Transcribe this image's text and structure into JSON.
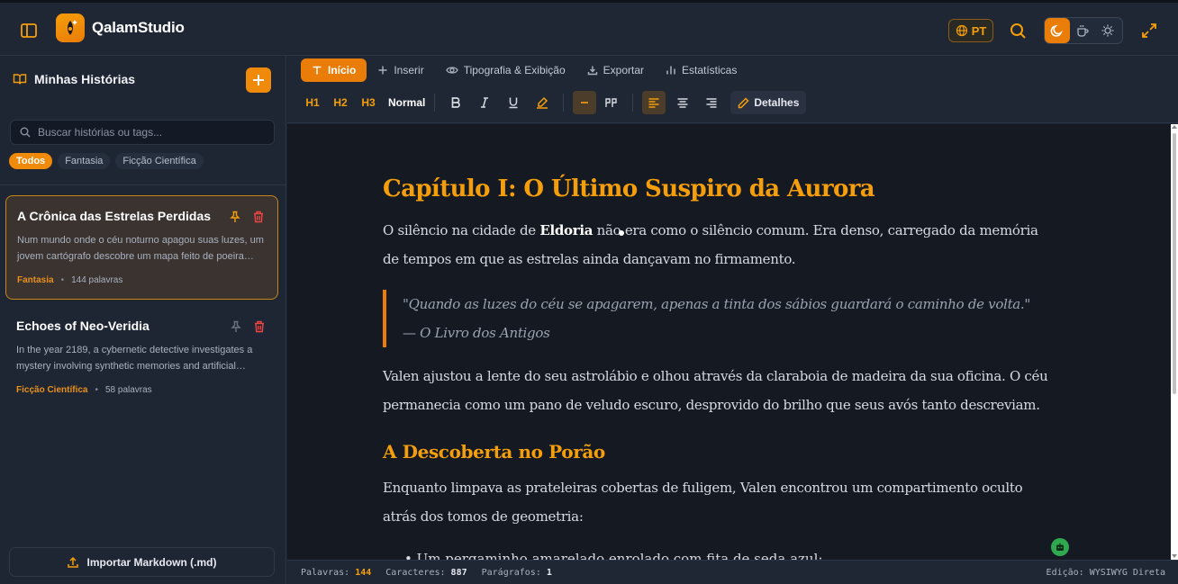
{
  "app": {
    "title": "QalamStudio",
    "language": "PT"
  },
  "sidebar": {
    "title": "Minhas Histórias",
    "search_placeholder": "Buscar histórias ou tags...",
    "tags": [
      "Todos",
      "Fantasia",
      "Ficção Científica"
    ],
    "active_tag": "Todos",
    "stories": [
      {
        "title": "A Crônica das Estrelas Perdidas",
        "excerpt": "Num mundo onde o céu noturno apagou suas luzes, um jovem cartógrafo descobre um mapa feito de poeira…",
        "genre": "Fantasia",
        "word_count": "144 palavras",
        "active": true
      },
      {
        "title": "Echoes of Neo-Veridia",
        "excerpt": "In the year 2189, a cybernetic detective investigates a mystery involving synthetic memories and artificial…",
        "genre": "Ficção Científica",
        "word_count": "58 palavras",
        "active": false
      }
    ],
    "import_label": "Importar Markdown (.md)"
  },
  "toolbar": {
    "tabs": [
      {
        "label": "Início",
        "icon": "text-t-icon"
      },
      {
        "label": "Inserir",
        "icon": "plus-icon"
      },
      {
        "label": "Tipografia & Exibição",
        "icon": "eye-icon"
      },
      {
        "label": "Exportar",
        "icon": "download-icon"
      },
      {
        "label": "Estatísticas",
        "icon": "bar-chart-icon"
      }
    ],
    "active_tab": "Início",
    "headings": [
      "H1",
      "H2",
      "H3"
    ],
    "normal_label": "Normal",
    "details_label": "Detalhes",
    "accent_color": "#ea7c08"
  },
  "document": {
    "title": "Capítulo I: O Último Suspiro da Aurora",
    "para1_before": "O silêncio na cidade de ",
    "para1_bold": "Eldoria",
    "para1_after": " não era como o silêncio comum. Era denso, carregado da memória de tempos em que as estrelas ainda dançavam no firmamento.",
    "quote_line1": "\"Quando as luzes do céu se apagarem, apenas a tinta dos sábios guardará o caminho de volta.\"",
    "quote_line2": "— O Livro dos Antigos",
    "para2": "Valen ajustou a lente do seu astrolábio e olhou através da claraboia de madeira da sua oficina. O céu permanecia como um pano de veludo escuro, desprovido do brilho que seus avós tanto descreviam.",
    "subtitle": "A Descoberta no Porão",
    "para3": "Enquanto limpava as prateleiras cobertas de fuligem, Valen encontrou um compartimento oculto atrás dos tomos de geometria:",
    "list_item": "Um pergaminho amarelado enrolado com fita de seda azul;"
  },
  "status": {
    "words_label": "Palavras:",
    "words": "144",
    "chars_label": "Caracteres:",
    "chars": "887",
    "paras_label": "Parágrafos:",
    "paras": "1",
    "mode": "Edição: WYSIWYG Direta"
  }
}
